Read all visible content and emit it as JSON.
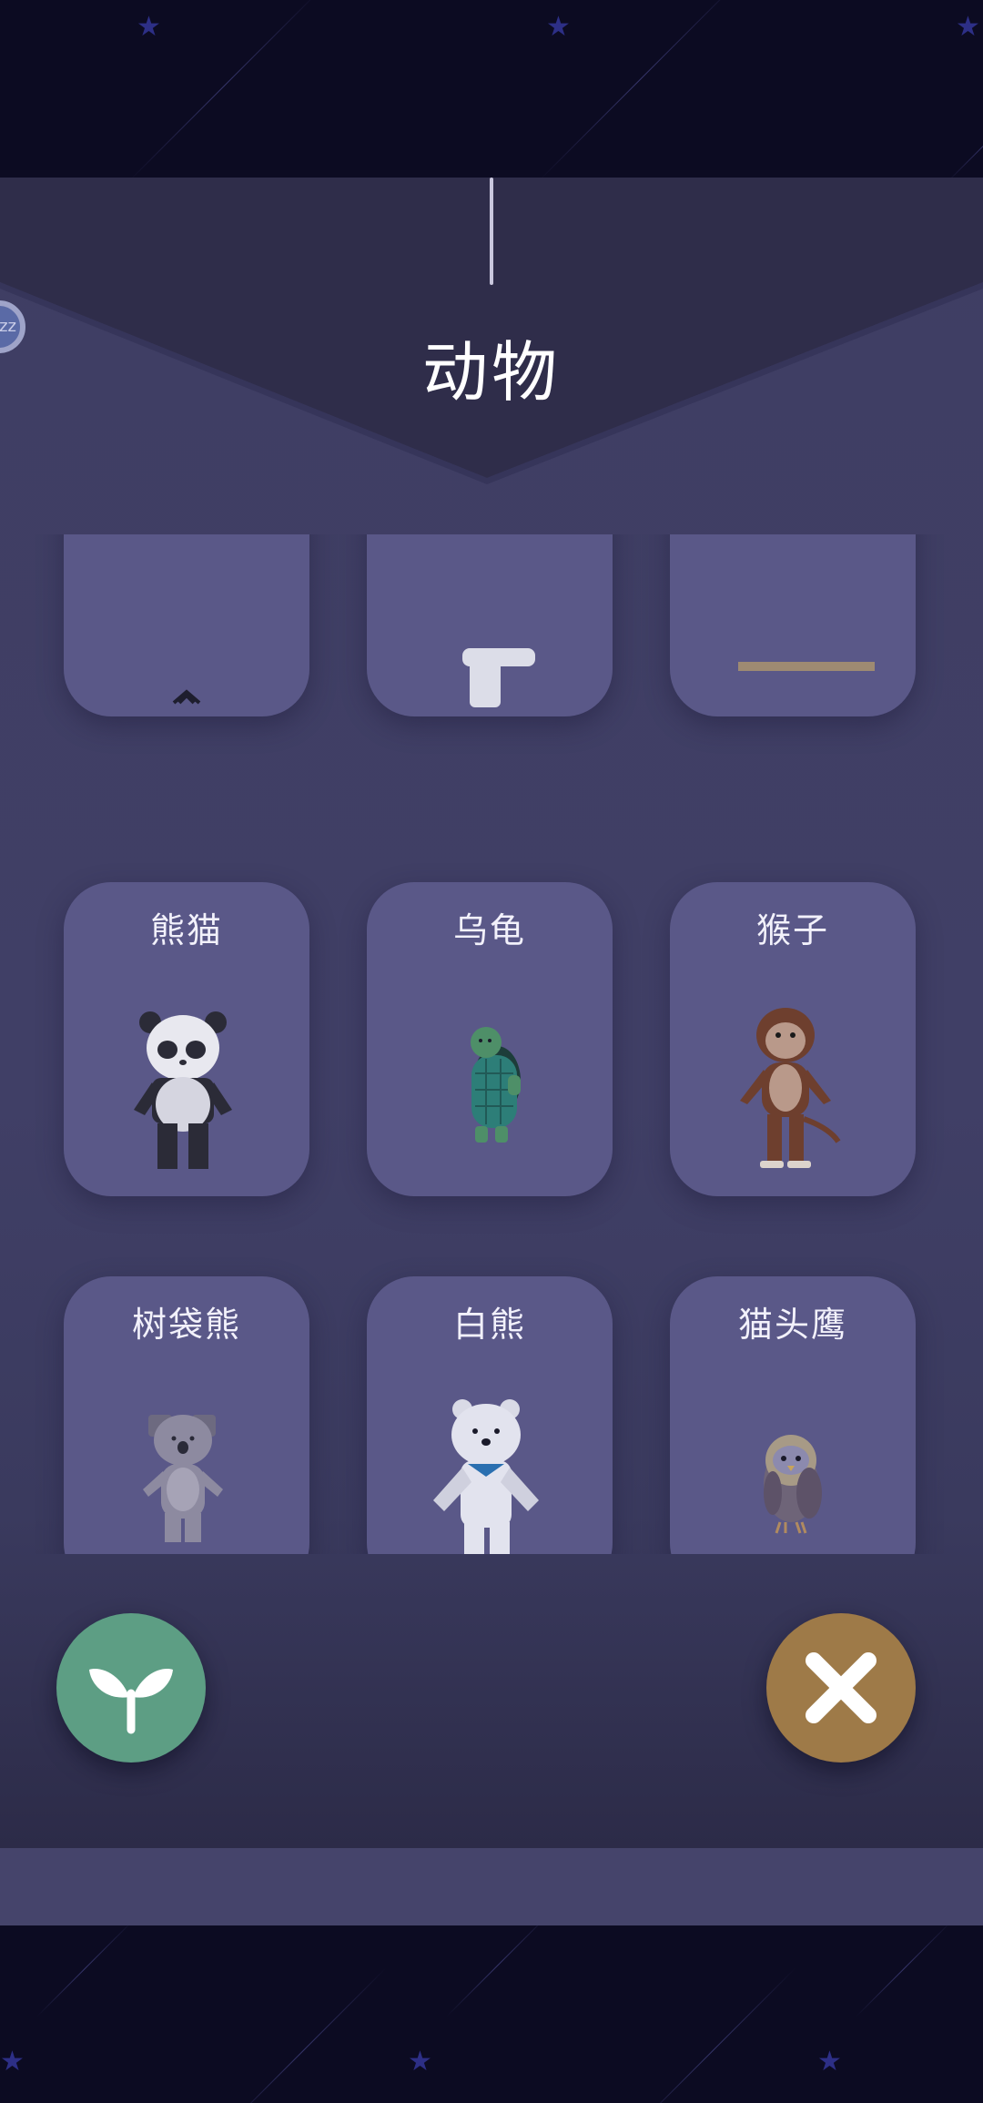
{
  "header": {
    "title": "动物"
  },
  "sleep_badge": {
    "text": "zz",
    "icon": "sleep-icon"
  },
  "animals": [
    {
      "label": "熊猫",
      "icon": "panda-icon"
    },
    {
      "label": "乌龟",
      "icon": "turtle-icon"
    },
    {
      "label": "猴子",
      "icon": "monkey-icon"
    },
    {
      "label": "树袋熊",
      "icon": "koala-icon"
    },
    {
      "label": "白熊",
      "icon": "polar-bear-icon"
    },
    {
      "label": "猫头鹰",
      "icon": "owl-icon"
    }
  ],
  "buttons": {
    "plant": {
      "icon": "sprout-icon",
      "color": "#5d9e84"
    },
    "close": {
      "icon": "close-icon",
      "color": "#9e7a48"
    }
  },
  "colors": {
    "panel": "#403f66",
    "card": "#5a5888",
    "banner": "#2f2d4a",
    "sky": "#0c0b22"
  }
}
